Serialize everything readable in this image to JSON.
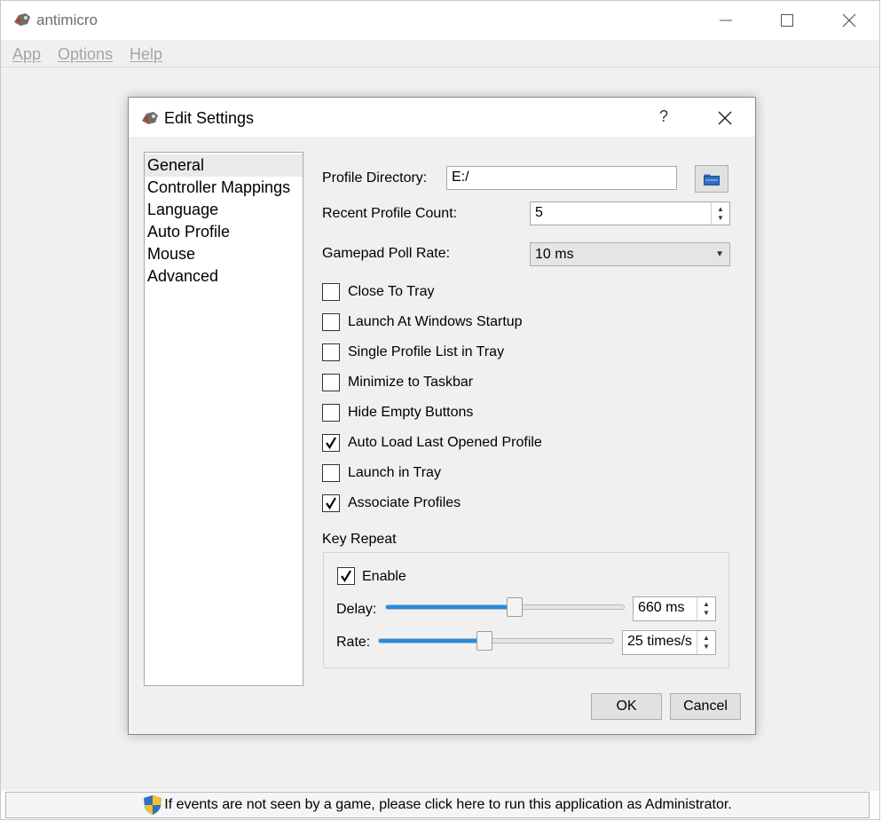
{
  "window": {
    "title": "antimicro"
  },
  "menu": {
    "items": [
      "App",
      "Options",
      "Help"
    ]
  },
  "dialog": {
    "title": "Edit Settings",
    "help_label": "?",
    "categories": [
      "General",
      "Controller Mappings",
      "Language",
      "Auto Profile",
      "Mouse",
      "Advanced"
    ],
    "selected_category": "General",
    "profile_directory": {
      "label": "Profile Directory:",
      "value": "E:/"
    },
    "recent_profile_count": {
      "label": "Recent Profile Count:",
      "value": "5"
    },
    "gamepad_poll_rate": {
      "label": "Gamepad Poll Rate:",
      "value": "10 ms"
    },
    "checkboxes": [
      {
        "label": "Close To Tray",
        "checked": false
      },
      {
        "label": "Launch At Windows Startup",
        "checked": false
      },
      {
        "label": "Single Profile List in Tray",
        "checked": false
      },
      {
        "label": "Minimize to Taskbar",
        "checked": false
      },
      {
        "label": "Hide Empty Buttons",
        "checked": false
      },
      {
        "label": "Auto Load Last Opened Profile",
        "checked": true
      },
      {
        "label": "Launch in Tray",
        "checked": false
      },
      {
        "label": "Associate Profiles",
        "checked": true
      }
    ],
    "key_repeat": {
      "title": "Key Repeat",
      "enable": {
        "label": "Enable",
        "checked": true
      },
      "delay": {
        "label": "Delay:",
        "value": "660 ms",
        "slider_fraction": 0.54
      },
      "rate": {
        "label": "Rate:",
        "value": "25 times/s",
        "slider_fraction": 0.45
      }
    },
    "ok_label": "OK",
    "cancel_label": "Cancel"
  },
  "status": {
    "message": "If events are not seen by a game, please click here to run this application as Administrator."
  },
  "colors": {
    "accent": "#1f8ee8",
    "background": "#f0f0f0"
  }
}
